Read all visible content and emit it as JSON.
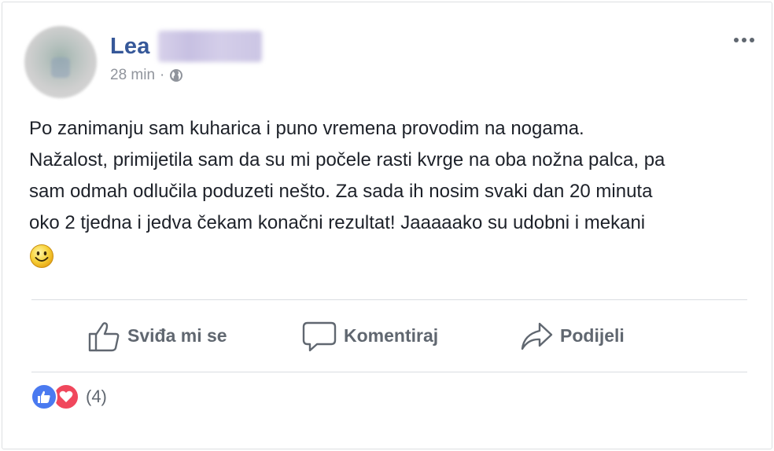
{
  "post": {
    "author": "Lea",
    "timestamp": "28 min",
    "separator": "·",
    "privacy_icon": "globe-icon",
    "text_lines": [
      "Po zanimanju sam kuharica i puno vremena provodim na nogama.",
      "Nažalost, primijetila sam da su mi počele rasti kvrge na oba nožna palca, pa",
      "sam odmah odlučila poduzeti nešto. Za sada ih nosim svaki dan 20 minuta",
      "oko 2 tjedna i jedva čekam konačni rezultat! Jaaaaako su udobni i mekani"
    ],
    "emoji": "smiley-icon"
  },
  "actions": {
    "like_label": "Sviđa mi se",
    "comment_label": "Komentiraj",
    "share_label": "Podijeli"
  },
  "reactions": {
    "icons": [
      "like-reaction-icon",
      "love-reaction-icon"
    ],
    "count": "(4)"
  },
  "colors": {
    "author": "#365899",
    "meta": "#90949c",
    "action_text": "#606770",
    "like_blue": "#4a7af0",
    "love_red": "#f0475c"
  }
}
